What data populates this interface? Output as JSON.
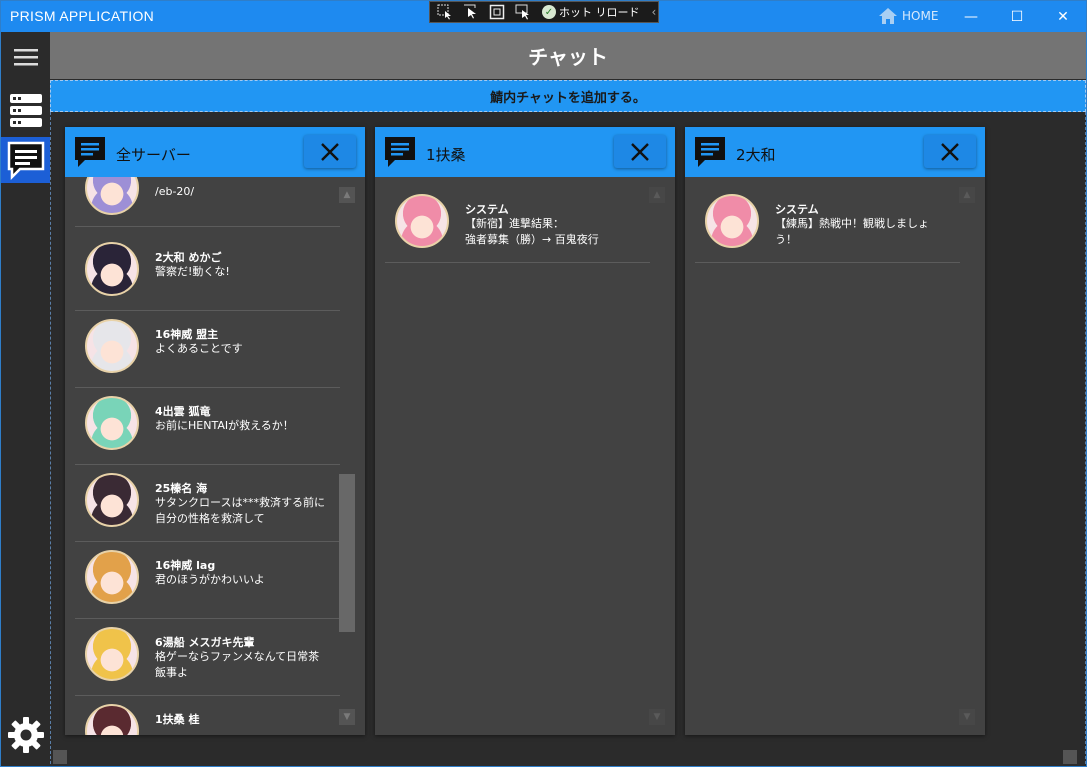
{
  "window": {
    "title": "PRISM APPLICATION",
    "home_label": "HOME",
    "controls": {
      "minimize": "—",
      "maximize": "☐",
      "close": "✕"
    }
  },
  "debug_toolbar": {
    "hot_reload_label": "ホット リロード",
    "tools": [
      "select-element-icon",
      "cursor-icon",
      "layout-adorner-icon",
      "track-focus-icon"
    ]
  },
  "nav": {
    "items": [
      {
        "icon": "hamburger-menu-icon"
      },
      {
        "icon": "server-list-icon"
      },
      {
        "icon": "chat-icon",
        "selected": true
      },
      {
        "icon": "settings-gear-icon"
      }
    ]
  },
  "header": {
    "title": "チャット",
    "add_label": "鯖内チャットを追加する。"
  },
  "panels": [
    {
      "name": "全サーバー",
      "scroll_up": "▲",
      "scroll_down": "▼",
      "scroll_position": 0.78,
      "messages": [
        {
          "author": "",
          "text": "/eb-20/",
          "avatar_hair": "#9d8fd6"
        },
        {
          "author": "2大和 めかご",
          "text": "警察だ!動くな!",
          "avatar_hair": "#2a2438"
        },
        {
          "author": "16神威 盟主",
          "text": "よくあることです",
          "avatar_hair": "#e6e6ea"
        },
        {
          "author": "4出雲 狐竜",
          "text": "お前にHENTAIが救えるか！",
          "avatar_hair": "#79d4b8"
        },
        {
          "author": "25榛名 海",
          "text": "サタンクロースは***救済する前に自分の性格を救済して",
          "avatar_hair": "#3a2a34"
        },
        {
          "author": "16神威 lag",
          "text": "君のほうがかわいいよ",
          "avatar_hair": "#e2a14a"
        },
        {
          "author": "6湯船 メスガキ先輩",
          "text": "格ゲーならファンメなんて日常茶飯事よ",
          "avatar_hair": "#f0c34a"
        },
        {
          "author": "1扶桑 桂",
          "text": "",
          "avatar_hair": "#5a2a30"
        }
      ]
    },
    {
      "name": "1扶桑",
      "scroll_up": "▲",
      "scroll_down": "▼",
      "messages": [
        {
          "author": "システム",
          "text": "【新宿】進撃結果：\n強者募集（勝）→ 百鬼夜行",
          "avatar_hair": "#f08ca8"
        }
      ]
    },
    {
      "name": "2大和",
      "scroll_up": "▲",
      "scroll_down": "▼",
      "messages": [
        {
          "author": "システム",
          "text": "【練馬】熱戦中！観戦しましょう！",
          "avatar_hair": "#f08ca8"
        }
      ]
    }
  ],
  "colors": {
    "accent": "#2196f3",
    "nav_selected": "#1c5fd6",
    "header_bg": "#747474",
    "panel_bg": "#424242",
    "app_bg": "#2b2b2b"
  }
}
